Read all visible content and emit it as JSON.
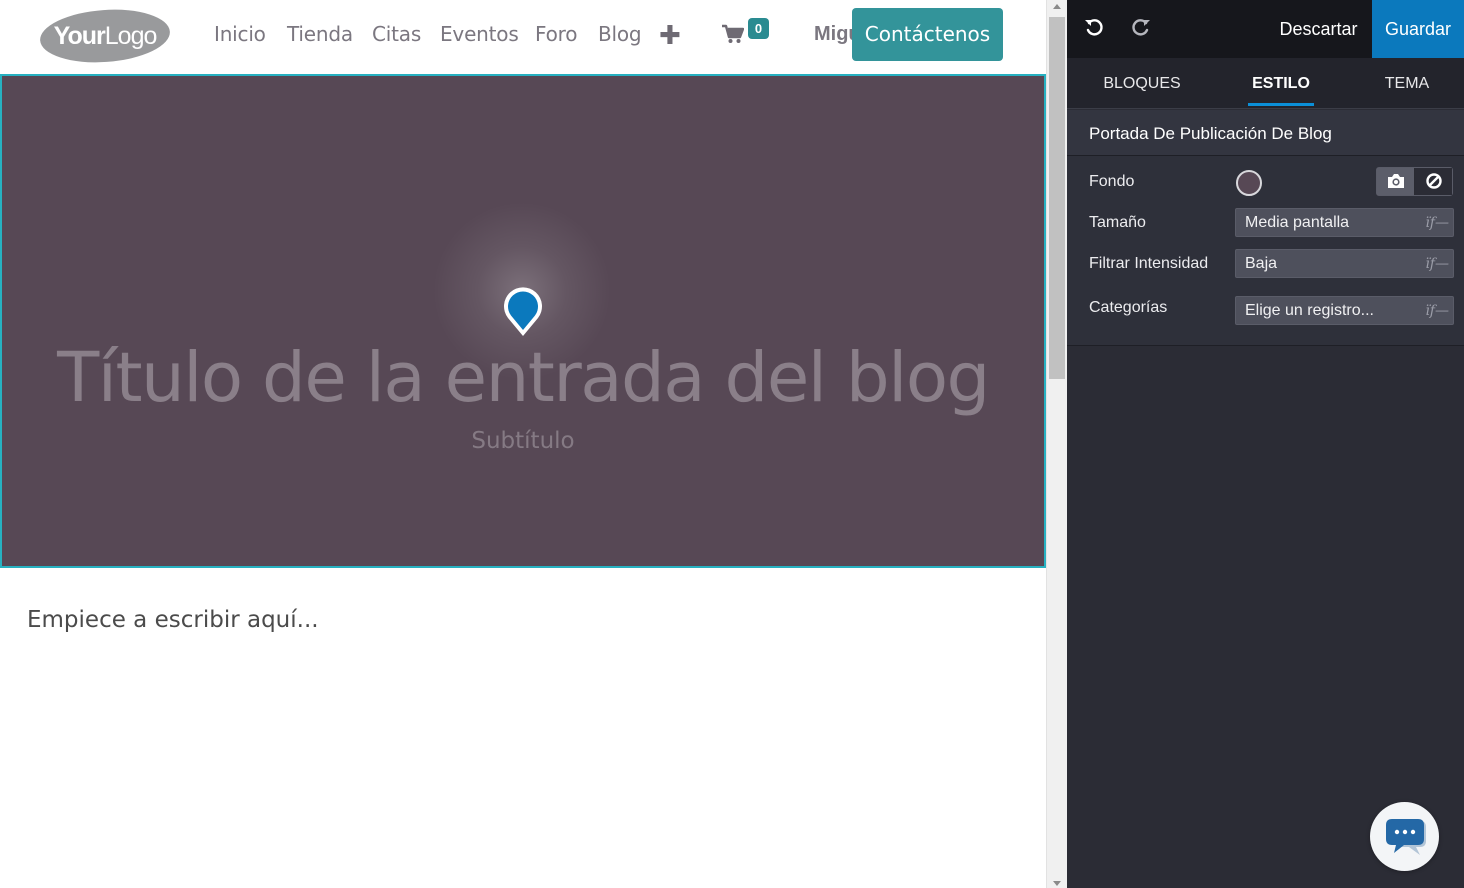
{
  "site": {
    "logo": {
      "bold": "Your",
      "light": "Logo"
    },
    "nav": [
      "Inicio",
      "Tienda",
      "Citas",
      "Eventos",
      "Foro",
      "Blog"
    ],
    "nav_plus_icon": "plus-icon",
    "cart": {
      "icon": "shopping-cart-icon",
      "count": "0"
    },
    "user_name": "Migu",
    "contact_button": "Contáctenos",
    "cover": {
      "title": "Título de la entrada del blog",
      "subtitle": "Subtítulo",
      "background_color": "#574855",
      "pin_icon": "map-pin-icon"
    },
    "body_placeholder": "Empiece a escribir aquí..."
  },
  "editor": {
    "toolbar": {
      "undo_icon": "undo-icon",
      "redo_icon": "redo-icon",
      "discard_label": "Descartar",
      "save_label": "Guardar"
    },
    "tabs": [
      {
        "label": "BLOQUES",
        "active": false
      },
      {
        "label": "ESTILO",
        "active": true
      },
      {
        "label": "TEMA",
        "active": false
      }
    ],
    "section_title": "Portada De Publicación De Blog",
    "options": {
      "background": {
        "label": "Fondo",
        "color": "#574855",
        "image_icon": "camera-icon",
        "none_icon": "ban-icon"
      },
      "size": {
        "label": "Tamaño",
        "value": "Media pantalla"
      },
      "filter": {
        "label": "Filtrar Intensidad",
        "value": "Baja"
      },
      "categories": {
        "label": "Categorías",
        "value": "Elige un registro..."
      }
    },
    "select_glyph": "ïf—"
  },
  "chat": {
    "icon": "chat-bubble-icon"
  },
  "colors": {
    "accent": "#0b79bd",
    "cover_bg": "#574855",
    "contact_btn": "#33949a",
    "panel_bg": "#2b2c35"
  }
}
